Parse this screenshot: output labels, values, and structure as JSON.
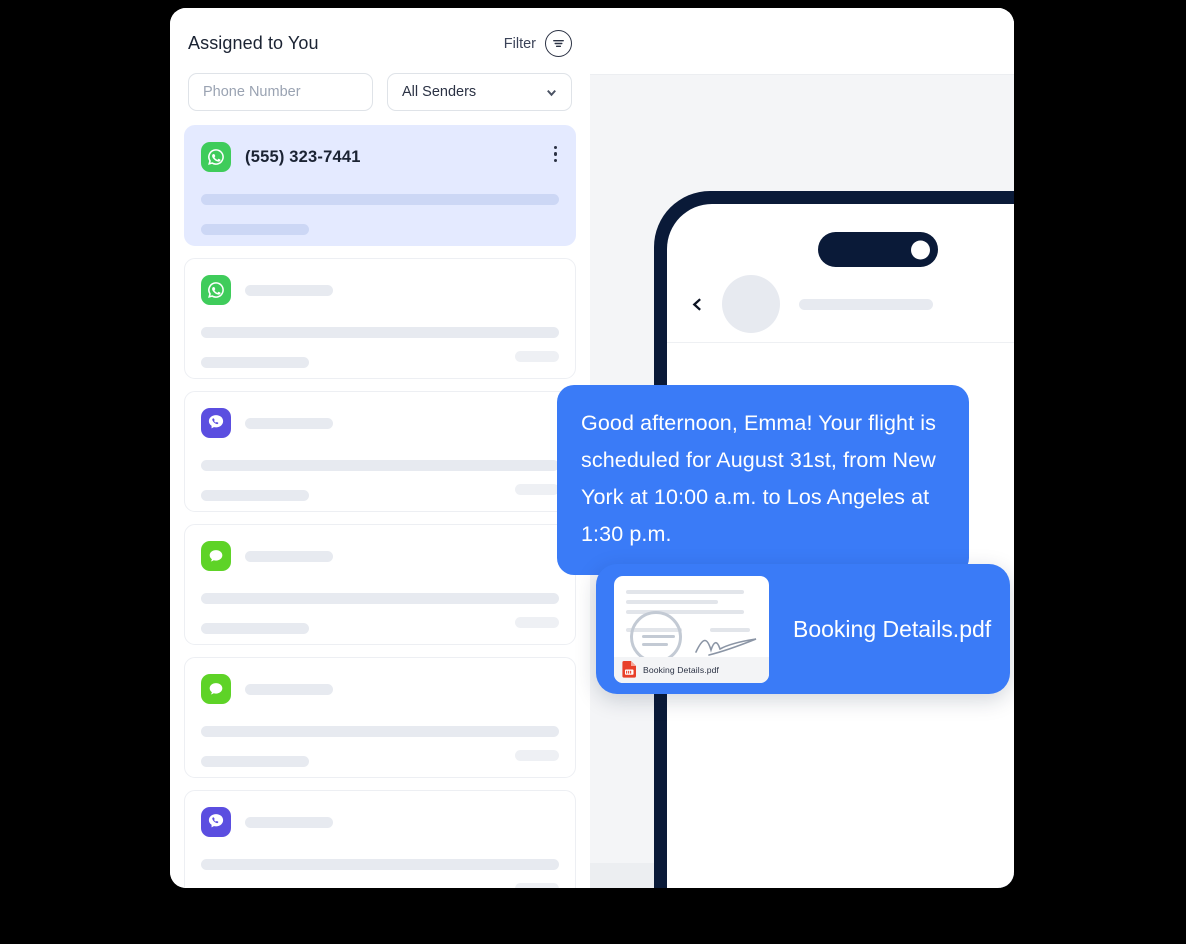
{
  "panel": {
    "list": {
      "title": "Assigned to You",
      "filter_label": "Filter",
      "filter_icon": "filter-circle-icon",
      "phone_input_placeholder": "Phone Number",
      "senders_value": "All Senders",
      "chevron_icon": "chevron-down-icon",
      "kebab_icon": "more-vertical-icon",
      "items": [
        {
          "channel": "whatsapp",
          "phone": "(555) 323-7441",
          "selected": true,
          "has_kebab": true
        },
        {
          "channel": "whatsapp",
          "phone": "",
          "selected": false,
          "has_kebab": false
        },
        {
          "channel": "viber",
          "phone": "",
          "selected": false,
          "has_kebab": false
        },
        {
          "channel": "sms",
          "phone": "",
          "selected": false,
          "has_kebab": false
        },
        {
          "channel": "sms",
          "phone": "",
          "selected": false,
          "has_kebab": false
        },
        {
          "channel": "viber",
          "phone": "",
          "selected": false,
          "has_kebab": false
        }
      ]
    },
    "conversation": {
      "composer_send_icon": "send-icon"
    }
  },
  "phone": {
    "back_icon": "chevron-left-icon",
    "avatar_icon": "avatar",
    "menu_icon": "avatar-small"
  },
  "messages": {
    "text_bubble": "Good afternoon, Emma! Your flight is scheduled for August 31st, from New York at 10:00 a.m. to Los Angeles at 1:30 p.m.",
    "file_bubble": {
      "name": "Booking Details.pdf",
      "thumb_caption": "Booking Details.pdf",
      "thumb_icon": "pdf-file-icon"
    }
  },
  "colors": {
    "accent_blue": "#3a7bf7",
    "selected_row": "#e4eaff",
    "phone_frame": "#0a1a38",
    "whatsapp_green": "#3fcc5b",
    "viber_purple": "#5b4ee0",
    "sms_green": "#5ed327",
    "pdf_red": "#e8402a"
  }
}
